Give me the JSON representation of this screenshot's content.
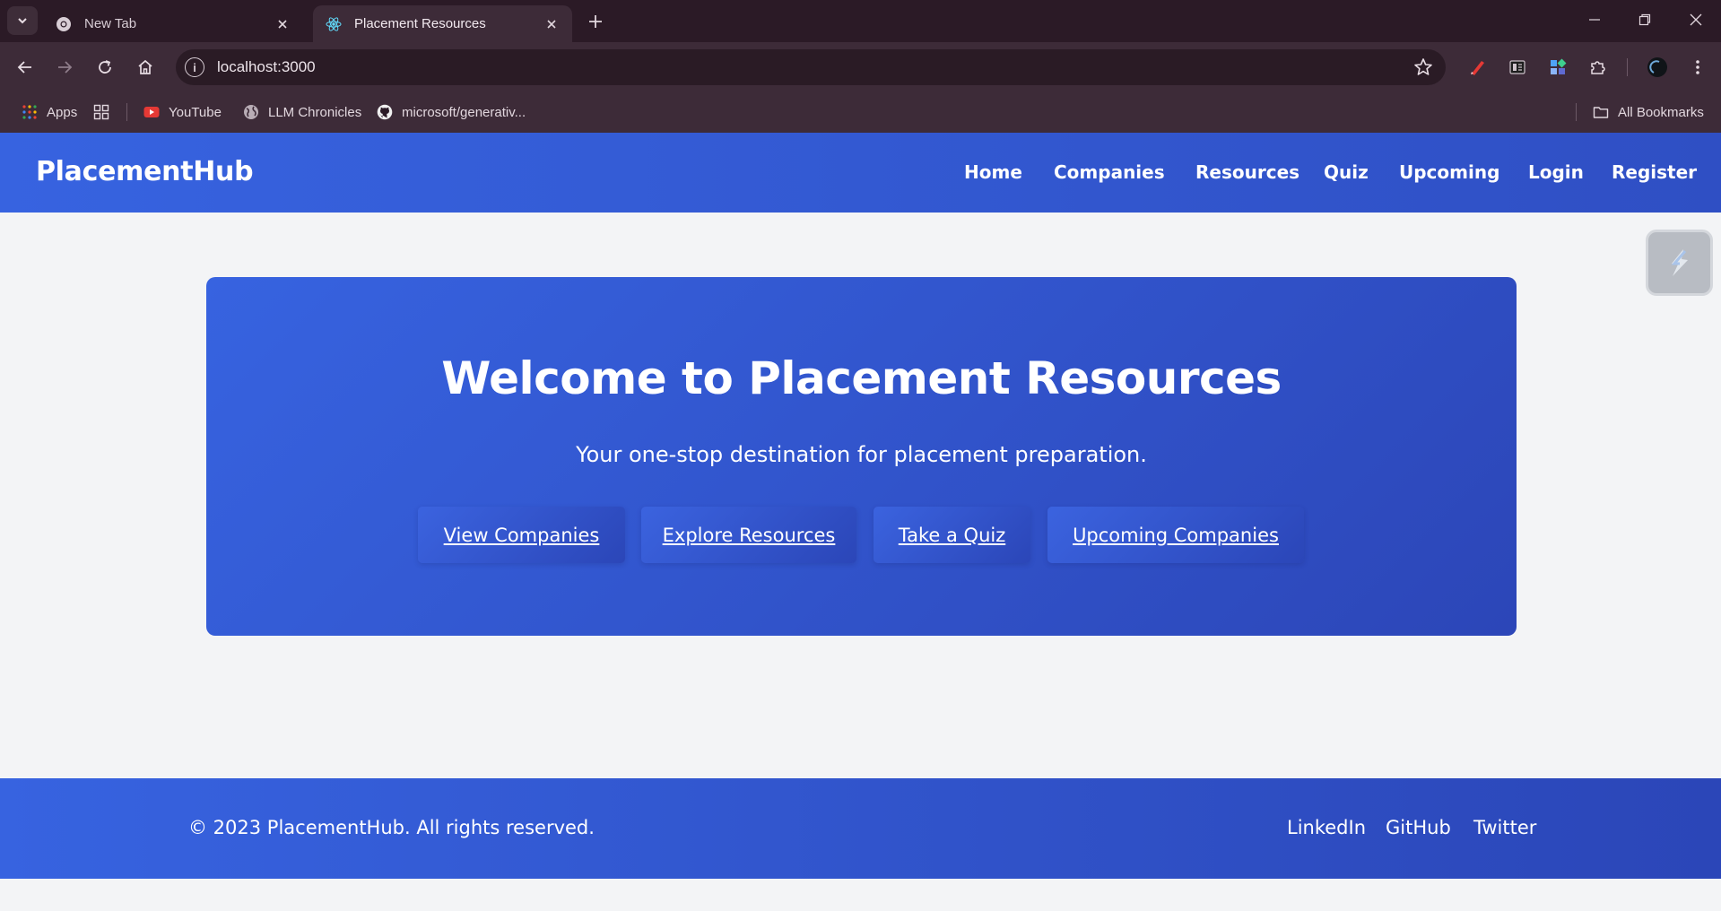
{
  "browser": {
    "tabs": [
      {
        "title": "New Tab",
        "active": false
      },
      {
        "title": "Placement Resources",
        "active": true
      }
    ],
    "url": "localhost:3000",
    "bookmarks": [
      {
        "label": "Apps",
        "icon": "apps-grid-icon"
      },
      {
        "label": "",
        "icon": "tab-groups-icon"
      },
      {
        "label": "YouTube",
        "icon": "youtube-icon"
      },
      {
        "label": "LLM Chronicles",
        "icon": "globe-icon"
      },
      {
        "label": "microsoft/generativ...",
        "icon": "github-icon"
      }
    ],
    "all_bookmarks_label": "All Bookmarks"
  },
  "site": {
    "brand": "PlacementHub",
    "nav": [
      "Home",
      "Companies",
      "Resources",
      "Quiz",
      "Upcoming",
      "Login",
      "Register"
    ],
    "hero": {
      "title": "Welcome to Placement Resources",
      "subtitle": "Your one-stop destination for placement preparation.",
      "buttons": [
        "View Companies",
        "Explore Resources",
        "Take a Quiz",
        "Upcoming Companies"
      ]
    },
    "footer": {
      "copyright": "© 2023 PlacementHub. All rights reserved.",
      "links": [
        "LinkedIn",
        "GitHub",
        "Twitter"
      ]
    }
  },
  "colors": {
    "accent_blue": "#3763e0",
    "accent_blue_dark": "#2b46b8",
    "page_background": "#f3f4f6",
    "browser_frame": "#2b1a26"
  }
}
